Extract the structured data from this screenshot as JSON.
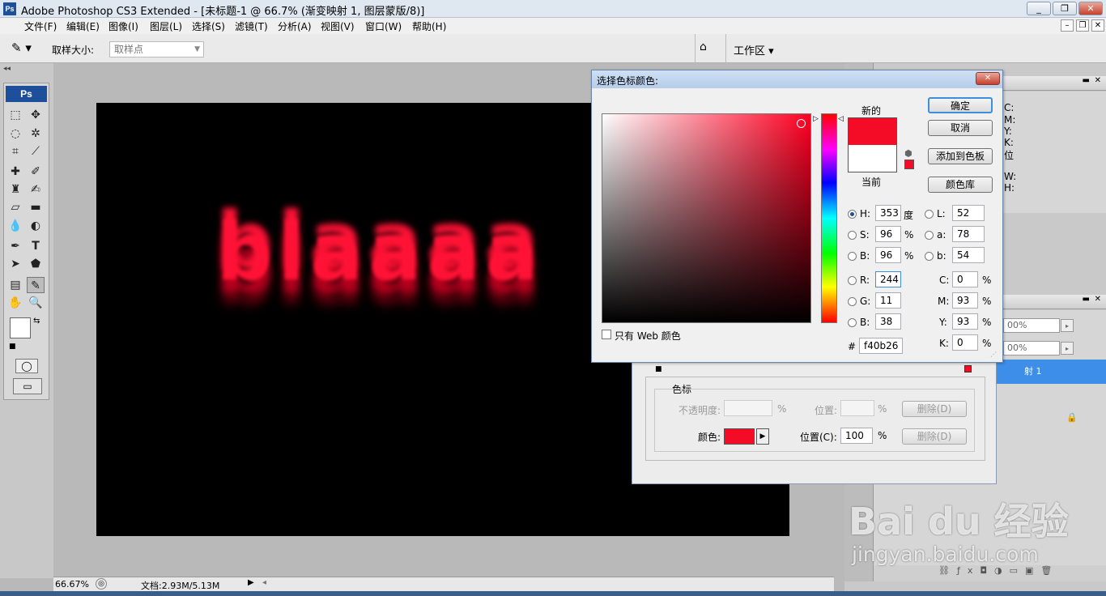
{
  "window": {
    "title": "Adobe Photoshop CS3 Extended - [未标题-1 @ 66.7% (渐变映射 1, 图层蒙版/8)]",
    "logo": "Ps"
  },
  "menu": [
    "文件(F)",
    "编辑(E)",
    "图像(I)",
    "图层(L)",
    "选择(S)",
    "滤镜(T)",
    "分析(A)",
    "视图(V)",
    "窗口(W)",
    "帮助(H)"
  ],
  "options": {
    "sample_size_label": "取样大小:",
    "sample_size_value": "取样点",
    "workspace_label": "工作区"
  },
  "canvas": {
    "text": "blaaaa",
    "text_color": "#f40b26",
    "background": "#000000"
  },
  "status": {
    "zoom": "66.67%",
    "doc": "文档:2.93M/5.13M"
  },
  "right_panel": {
    "info_labels": [
      "C:",
      "M:",
      "Y:",
      "K:",
      "位",
      "W:",
      "H:"
    ],
    "layer_rows": [
      "00%",
      "00%",
      "射 1"
    ]
  },
  "gradient_editor": {
    "section": "色标",
    "opacity_label": "不透明度:",
    "opacity_unit": "%",
    "location_label": "位置:",
    "location_unit": "%",
    "delete1": "删除(D)",
    "color_label": "颜色:",
    "stop_color": "#f40b26",
    "location_c_label": "位置(C):",
    "location_c_value": "100",
    "location_c_unit": "%",
    "delete2": "删除(D)"
  },
  "color_picker": {
    "title": "选择色标颜色:",
    "new_label": "新的",
    "current_label": "当前",
    "new_color": "#f40b26",
    "current_color": "#ffffff",
    "buttons": {
      "ok": "确定",
      "cancel": "取消",
      "add_swatch": "添加到色板",
      "libraries": "颜色库"
    },
    "web_only_label": "只有 Web 颜色",
    "hsb": {
      "H": "353",
      "S": "96",
      "B": "96",
      "h_unit": "度",
      "s_unit": "%",
      "b_unit": "%"
    },
    "lab": {
      "L": "52",
      "a": "78",
      "b": "54"
    },
    "rgb": {
      "R": "244",
      "G": "11",
      "B": "38"
    },
    "cmyk": {
      "C": "0",
      "M": "93",
      "Y": "93",
      "K": "0",
      "unit": "%"
    },
    "hex_label": "#",
    "hex": "f40b26",
    "hue_base": "#ff0022",
    "labels": {
      "H": "H:",
      "S": "S:",
      "B": "B:",
      "L": "L:",
      "a": "a:",
      "b": "b:",
      "R": "R:",
      "G": "G:",
      "B2": "B:",
      "C": "C:",
      "M": "M:",
      "Y": "Y:",
      "K": "K:"
    }
  },
  "watermark": {
    "brand": "Bai du 经验",
    "url": "jingyan.baidu.com"
  }
}
